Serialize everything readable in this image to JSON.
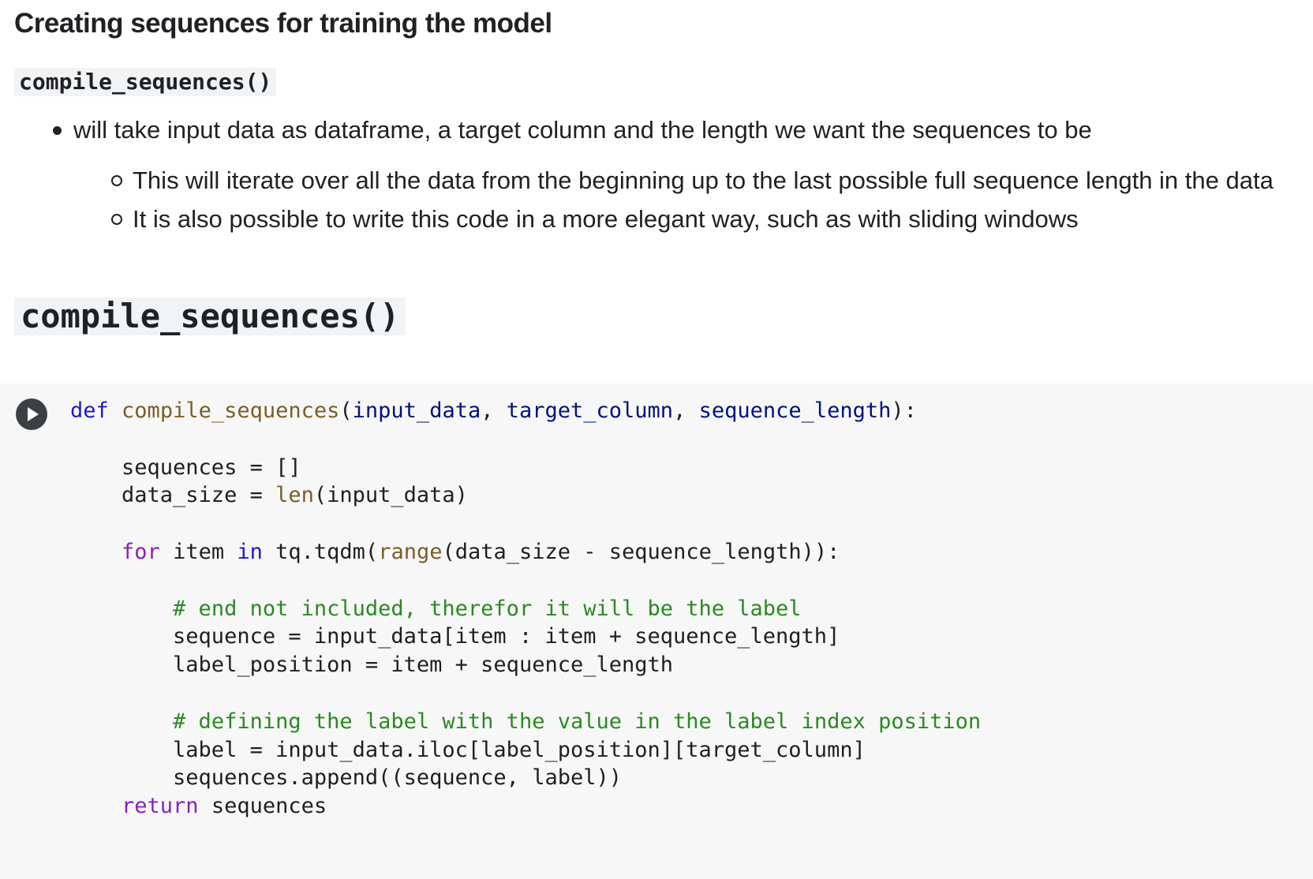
{
  "markdown": {
    "heading": "Creating sequences for training the model",
    "function_code": "compile_sequences()",
    "bullets": [
      "will take input data as dataframe, a target column and the length we want the sequences to be"
    ],
    "sub_bullets": [
      "This will iterate over all the data from the beginning up to the last possible full sequence length in the data",
      "It is also possible to write this code in a more elegant way, such as with sliding windows"
    ]
  },
  "section_heading_code": "compile_sequences()",
  "code_cell": {
    "run_button_icon": "play-icon",
    "colors": {
      "keyword": "#1a1acd",
      "control_keyword": "#8a1fbf",
      "function_name": "#795e26",
      "parameter": "#001080",
      "comment": "#2a8a22",
      "background": "#f7f7f7"
    },
    "lines": [
      [
        {
          "t": "def",
          "c": "kw"
        },
        {
          "t": " "
        },
        {
          "t": "compile_sequences",
          "c": "fn"
        },
        {
          "t": "("
        },
        {
          "t": "input_data",
          "c": "param"
        },
        {
          "t": ", "
        },
        {
          "t": "target_column",
          "c": "param"
        },
        {
          "t": ", "
        },
        {
          "t": "sequence_length",
          "c": "param"
        },
        {
          "t": "):"
        }
      ],
      [],
      [
        {
          "t": "    sequences = []"
        }
      ],
      [
        {
          "t": "    data_size = "
        },
        {
          "t": "len",
          "c": "fn"
        },
        {
          "t": "(input_data)"
        }
      ],
      [],
      [
        {
          "t": "    "
        },
        {
          "t": "for",
          "c": "kw2"
        },
        {
          "t": " item "
        },
        {
          "t": "in",
          "c": "kw"
        },
        {
          "t": " tq.tqdm("
        },
        {
          "t": "range",
          "c": "fn"
        },
        {
          "t": "(data_size - sequence_length)):"
        }
      ],
      [],
      [
        {
          "t": "        "
        },
        {
          "t": "# end not included, therefor it will be the label",
          "c": "cm"
        }
      ],
      [
        {
          "t": "        sequence = input_data[item : item + sequence_length]"
        }
      ],
      [
        {
          "t": "        label_position = item + sequence_length"
        }
      ],
      [],
      [
        {
          "t": "        "
        },
        {
          "t": "# defining the label with the value in the label index position",
          "c": "cm"
        }
      ],
      [
        {
          "t": "        label = input_data.iloc[label_position][target_column]"
        }
      ],
      [
        {
          "t": "        sequences.append((sequence, label))"
        }
      ],
      [
        {
          "t": "    "
        },
        {
          "t": "return",
          "c": "kw2"
        },
        {
          "t": " sequences"
        }
      ]
    ]
  }
}
